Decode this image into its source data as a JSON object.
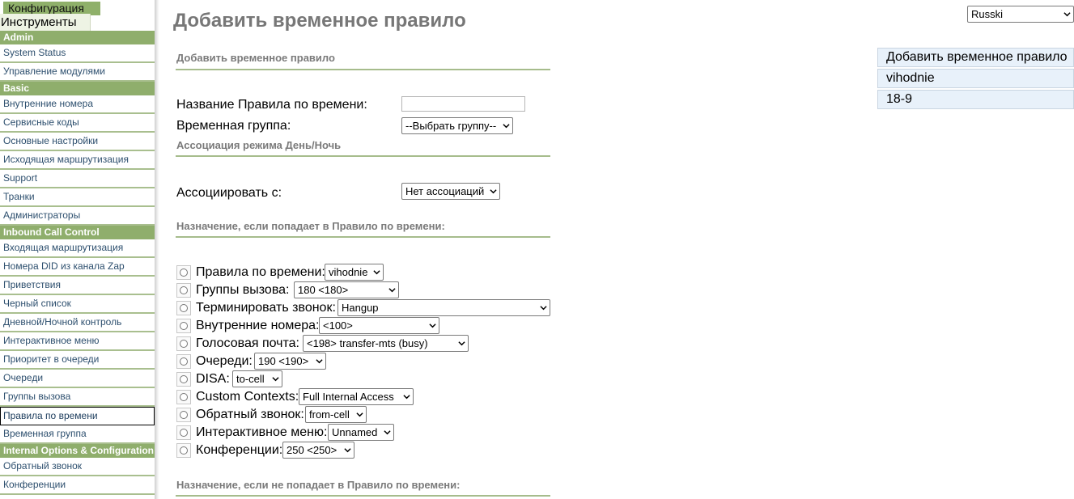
{
  "sidebar": {
    "tabs": [
      "Конфигурация",
      "Инструменты"
    ],
    "sections": [
      {
        "title": "Admin",
        "items": [
          "System Status",
          "Управление модулями"
        ]
      },
      {
        "title": "Basic",
        "items": [
          "Внутренние номера",
          "Сервисные коды",
          "Основные настройки",
          "Исходящая маршрутизация",
          "Support",
          "Транки",
          "Администраторы"
        ]
      },
      {
        "title": "Inbound Call Control",
        "items": [
          "Входящая маршрутизация",
          "Номера DID из канала Zap",
          "Приветствия",
          "Черный список",
          "Дневной/Ночной контроль",
          "Интерактивное меню",
          "Приоритет в очереди",
          "Очереди",
          "Группы вызова",
          "Правила по времени",
          "Временная группа"
        ]
      },
      {
        "title": "Internal Options & Configuration",
        "items": [
          "Обратный звонок",
          "Конференции"
        ]
      }
    ],
    "active_item": "Правила по времени"
  },
  "main": {
    "page_title": "Добавить временное правило",
    "section1_title": "Добавить временное правило",
    "rule_name_label": "Название Правила по времени:",
    "rule_name_value": "",
    "time_group_label": "Временная группа:",
    "time_group_value": "--Выбрать группу--",
    "section2_title": "Ассоциация режима День/Ночь",
    "associate_label": "Ассоциировать с:",
    "associate_value": "Нет ассоциаций",
    "section3_title": "Назначение, если попадает в Правило по времени:",
    "destinations": [
      {
        "label": "Правила по времени:",
        "value": "vihodnie"
      },
      {
        "label": "Группы вызова:",
        "value": "180 <180>"
      },
      {
        "label": "Терминировать звонок:",
        "value": "Hangup"
      },
      {
        "label": "Внутренние номера:",
        "value": "<100>"
      },
      {
        "label": "Голосовая почта:",
        "value": "<198> transfer-mts (busy)"
      },
      {
        "label": "Очереди:",
        "value": "190 <190>"
      },
      {
        "label": "DISA:",
        "value": "to-cell"
      },
      {
        "label": "Custom Contexts:",
        "value": "Full Internal Access"
      },
      {
        "label": "Обратный звонок:",
        "value": "from-cell"
      },
      {
        "label": "Интерактивное меню:",
        "value": "Unnamed"
      },
      {
        "label": "Конференции:",
        "value": "250 <250>"
      }
    ],
    "section4_title": "Назначение, если не попадает в Правило по времени:"
  },
  "right_panel": {
    "language": "Russki",
    "rules": [
      "Добавить временное правило",
      "vihodnie",
      "18-9"
    ]
  },
  "colors": {
    "sidebar_section_bg": "#8fae6c",
    "sidebar_item_border": "#a9bf8f",
    "sidebar_link": "#2d4f6e",
    "title_gray": "#777777",
    "rule_list_bg": "#e8f1fa"
  },
  "icons": [
    "chevron-down-icon",
    "radio-button-icon"
  ]
}
